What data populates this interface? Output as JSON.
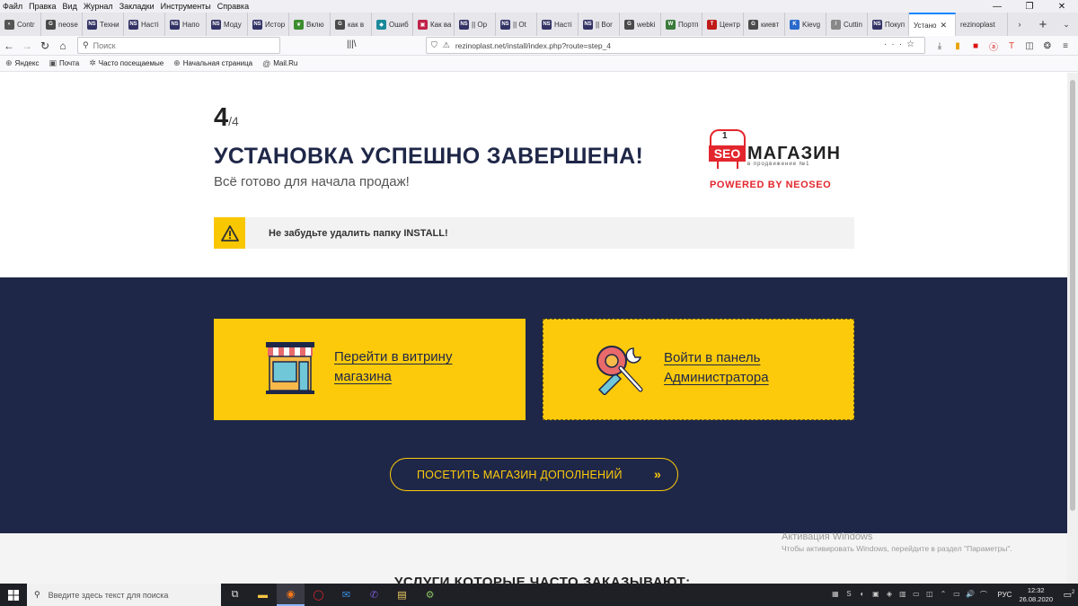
{
  "window": {
    "menu": [
      "Файл",
      "Правка",
      "Вид",
      "Журнал",
      "Закладки",
      "Инструменты",
      "Справка"
    ],
    "controls": [
      "—",
      "❐",
      "✕"
    ]
  },
  "tabs": [
    {
      "label": "Contr",
      "color": "#555555",
      "glyph": "◐"
    },
    {
      "label": "neose",
      "color": "#4a4a4a",
      "glyph": "G"
    },
    {
      "label": "Техни",
      "color": "#333366",
      "glyph": "NS"
    },
    {
      "label": "Насті",
      "color": "#333366",
      "glyph": "NS"
    },
    {
      "label": "Напо",
      "color": "#333366",
      "glyph": "NS"
    },
    {
      "label": "Моду",
      "color": "#333366",
      "glyph": "NS"
    },
    {
      "label": "Истор",
      "color": "#333366",
      "glyph": "NS"
    },
    {
      "label": "Вклю",
      "color": "#3c8d2f",
      "glyph": "❦"
    },
    {
      "label": "как в",
      "color": "#4a4a4a",
      "glyph": "G"
    },
    {
      "label": "Ошиб",
      "color": "#1a8a9a",
      "glyph": "◆"
    },
    {
      "label": "Как ва",
      "color": "#c0234a",
      "glyph": "▣"
    },
    {
      "label": "|| Op",
      "color": "#333366",
      "glyph": "NS"
    },
    {
      "label": "|| Ot",
      "color": "#333366",
      "glyph": "NS"
    },
    {
      "label": "Насті",
      "color": "#333366",
      "glyph": "NS"
    },
    {
      "label": "|| Bor",
      "color": "#333366",
      "glyph": "NS"
    },
    {
      "label": "webki",
      "color": "#4a4a4a",
      "glyph": "G"
    },
    {
      "label": "Портп",
      "color": "#3a7a3a",
      "glyph": "W"
    },
    {
      "label": "Центр",
      "color": "#c01a1a",
      "glyph": "T"
    },
    {
      "label": "киевт",
      "color": "#4a4a4a",
      "glyph": "G"
    },
    {
      "label": "Kievg",
      "color": "#2a6acc",
      "glyph": "K"
    },
    {
      "label": "Cuttin",
      "color": "#888888",
      "glyph": "/"
    },
    {
      "label": "Покуп",
      "color": "#333366",
      "glyph": "NS"
    }
  ],
  "active_tab": {
    "label": "Устано",
    "close": "✕"
  },
  "extra_tab": {
    "label": "rezinoplast"
  },
  "nav": {
    "search_placeholder": "Поиск",
    "url": "rezinoplast.net/install/index.php?route=step_4",
    "url_right": "···☆",
    "library": "|||\\"
  },
  "toolbar_icons": [
    "⤓",
    "▮",
    "■",
    "ⓐ",
    "T",
    "◫",
    "❂",
    "≡"
  ],
  "bookmarks": [
    {
      "label": "Яндекс",
      "icon": "⊕"
    },
    {
      "label": "Почта",
      "icon": "▣"
    },
    {
      "label": "Часто посещаемые",
      "icon": "✲"
    },
    {
      "label": "Начальная страница",
      "icon": "⊕"
    },
    {
      "label": "Mail.Ru",
      "icon": "@"
    }
  ],
  "page": {
    "step_current": "4",
    "step_total": "/4",
    "title": "УСТАНОВКА УСПЕШНО ЗАВЕРШЕНА!",
    "subtitle": "Всё готово для начала продаж!",
    "logo": {
      "seo": "SEO",
      "number": "1",
      "name": "МАГАЗИН",
      "tagline": "в продвижение №1"
    },
    "powered": "POWERED BY NEOSEO",
    "notice": "Не забудьте удалить папку INSTALL!",
    "card_store": [
      "Перейти в витрину",
      "магазина"
    ],
    "card_admin": [
      "Войти в панель",
      "Администратора"
    ],
    "addons_button": "ПОСЕТИТЬ МАГАЗИН ДОПОЛНЕНИЙ",
    "addons_chevron": "»",
    "services_heading": "УСЛУГИ КОТОРЫЕ ЧАСТО ЗАКАЗЫВАЮТ:"
  },
  "activation": {
    "title": "Активация Windows",
    "text": "Чтобы активировать Windows, перейдите в раздел \"Параметры\"."
  },
  "taskbar": {
    "search_placeholder": "Введите здесь текст для поиска",
    "apps": [
      "⧉",
      "▬",
      "◉",
      "◯",
      "✉",
      "✆",
      "▤",
      "⚙"
    ],
    "tray_icons": [
      "▦",
      "S",
      "◐",
      "▣",
      "◈",
      "▥",
      "▭",
      "◫",
      "⌃",
      "▭",
      "🔊",
      "⌒"
    ],
    "lang": "РУС",
    "time": "12:32",
    "date": "26.08.2020",
    "notify_count": "2"
  }
}
